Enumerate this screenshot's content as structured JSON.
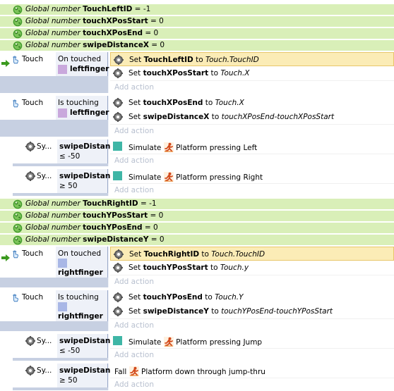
{
  "colors": {
    "global_var_bg": "#d9efb8",
    "cond_bg": "#c7d0e2",
    "highlight": "#fbecb6",
    "teal": "#3fb6a6",
    "add_action": "#b8c0cf"
  },
  "globals1": [
    {
      "kw": "Global number",
      "name": "TouchLeftID",
      "eq": " = -1"
    },
    {
      "kw": "Global number",
      "name": "touchXPosStart",
      "eq": " = 0"
    },
    {
      "kw": "Global number",
      "name": "touchXPosEnd",
      "eq": " = 0"
    },
    {
      "kw": "Global number",
      "name": "swipeDistanceX",
      "eq": " = 0"
    }
  ],
  "globals2": [
    {
      "kw": "Global number",
      "name": "TouchRightID",
      "eq": " = -1"
    },
    {
      "kw": "Global number",
      "name": "touchYPosStart",
      "eq": " = 0"
    },
    {
      "kw": "Global number",
      "name": "touchYPosEnd",
      "eq": " = 0"
    },
    {
      "kw": "Global number",
      "name": "swipeDistanceY",
      "eq": " = 0"
    }
  ],
  "add_action": "Add action",
  "ev1": {
    "obj": "Touch",
    "cond": "On touched",
    "param": "leftfinger",
    "a1": {
      "pre": "Set ",
      "var": "TouchLeftID",
      "mid": " to ",
      "expr": "Touch.TouchID"
    },
    "a2": {
      "pre": "Set ",
      "var": "touchXPosStart",
      "mid": " to ",
      "expr": "Touch.X"
    }
  },
  "ev2": {
    "obj": "Touch",
    "cond": "Is touching",
    "param": "leftfinger",
    "a1": {
      "pre": "Set ",
      "var": "touchXPosEnd",
      "mid": " to ",
      "expr": "Touch.X"
    },
    "a2": {
      "pre": "Set ",
      "var": "swipeDistanceX",
      "mid": " to ",
      "expr": "touchXPosEnd-touchXPosStart"
    }
  },
  "sub1": {
    "obj": "Sy...",
    "var": "swipeDistance",
    "cmp": "≤ -50",
    "act": "Simulate",
    "plat": "Platform pressing Left"
  },
  "sub2": {
    "obj": "Sy...",
    "var": "swipeDistance",
    "cmp": "≥ 50",
    "act": "Simulate",
    "plat": "Platform pressing Right"
  },
  "ev3": {
    "obj": "Touch",
    "cond": "On touched",
    "param": "rightfinger",
    "a1": {
      "pre": "Set ",
      "var": "TouchRightID",
      "mid": " to ",
      "expr": "Touch.TouchID"
    },
    "a2": {
      "pre": "Set ",
      "var": "touchYPosStart",
      "mid": " to ",
      "expr": "Touch.y"
    }
  },
  "ev4": {
    "obj": "Touch",
    "cond": "Is touching",
    "param": "rightfinger",
    "a1": {
      "pre": "Set ",
      "var": "touchYPosEnd",
      "mid": " to ",
      "expr": "Touch.Y"
    },
    "a2": {
      "pre": "Set ",
      "var": "swipeDistanceY",
      "mid": " to ",
      "expr": "touchYPosEnd-touchYPosStart"
    }
  },
  "sub3": {
    "obj": "Sy...",
    "var": "swipeDistance",
    "cmp": "≤ -50",
    "act": "Simulate",
    "plat": "Platform pressing Jump"
  },
  "sub4": {
    "obj": "Sy...",
    "var": "swipeDistance",
    "cmp": "≥ 50",
    "act": "Fall",
    "plat": "Platform down through jump-thru"
  }
}
